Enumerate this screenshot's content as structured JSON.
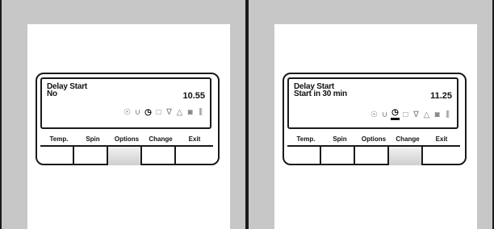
{
  "panels": [
    {
      "title": "Delay Start",
      "value": "No",
      "time": "10.55",
      "highlight": "Options",
      "active_icon": 2,
      "underline_icon": -1
    },
    {
      "title": "Delay Start",
      "value": "Start in 30 min",
      "time": "11.25",
      "highlight": "Change",
      "active_icon": 2,
      "underline_icon": 2
    }
  ],
  "buttons": [
    "Temp.",
    "Spin",
    "Options",
    "Change",
    "Exit"
  ],
  "icons": [
    "prewash-icon",
    "intensive-icon",
    "delay-start-icon",
    "rinse-hold-icon",
    "easy-iron-icon",
    "extra-rinse-icon",
    "gentle-icon",
    "stain-icon"
  ]
}
